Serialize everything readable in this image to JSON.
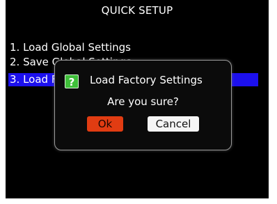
{
  "screen": {
    "title": "QUICK SETUP",
    "menu": [
      {
        "label": "1. Load Global Settings"
      },
      {
        "label": "2. Save Global Settings"
      },
      {
        "label": "3. Load Factory Settings",
        "selected": true
      }
    ]
  },
  "dialog": {
    "icon": "question-icon",
    "icon_glyph": "?",
    "title": "Load Factory Settings",
    "message": "Are you sure?",
    "ok_label": "Ok",
    "cancel_label": "Cancel"
  },
  "colors": {
    "screen_bg": "#000000",
    "highlight": "#1c10ee",
    "ok_button": "#e13c12",
    "icon_bg": "#3fbf3a"
  }
}
